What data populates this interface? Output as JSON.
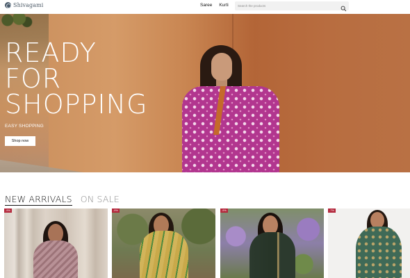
{
  "header": {
    "brand": "Shivagami",
    "nav": [
      "Saree",
      "Kurti"
    ],
    "search_placeholder": "Search the products"
  },
  "hero": {
    "title_lines": [
      "READY",
      "FOR",
      "SHOPPING"
    ],
    "subtitle": "EASY SHOPPING",
    "cta": "Shop now"
  },
  "tabs": {
    "new_arrivals": "NEW ARRIVALS",
    "on_sale": "ON SALE",
    "active": "new_arrivals"
  },
  "products": [
    {
      "badge": "-9%",
      "image": "woman in mauve embroidered saree before stone pillars"
    },
    {
      "badge": "-9%",
      "image": "woman in yellow and green silk saree among trees"
    },
    {
      "badge": "-9%",
      "image": "woman in dark green saree with purple flowers"
    },
    {
      "badge": "-7%",
      "image": "woman in teal green saree on white background"
    }
  ],
  "icons": {
    "search": "search-icon",
    "logo": "brand-logo-icon"
  },
  "colors": {
    "badge": "#b3263a",
    "hero_wall": "#b86d40",
    "hero_top": "#b2368f"
  }
}
